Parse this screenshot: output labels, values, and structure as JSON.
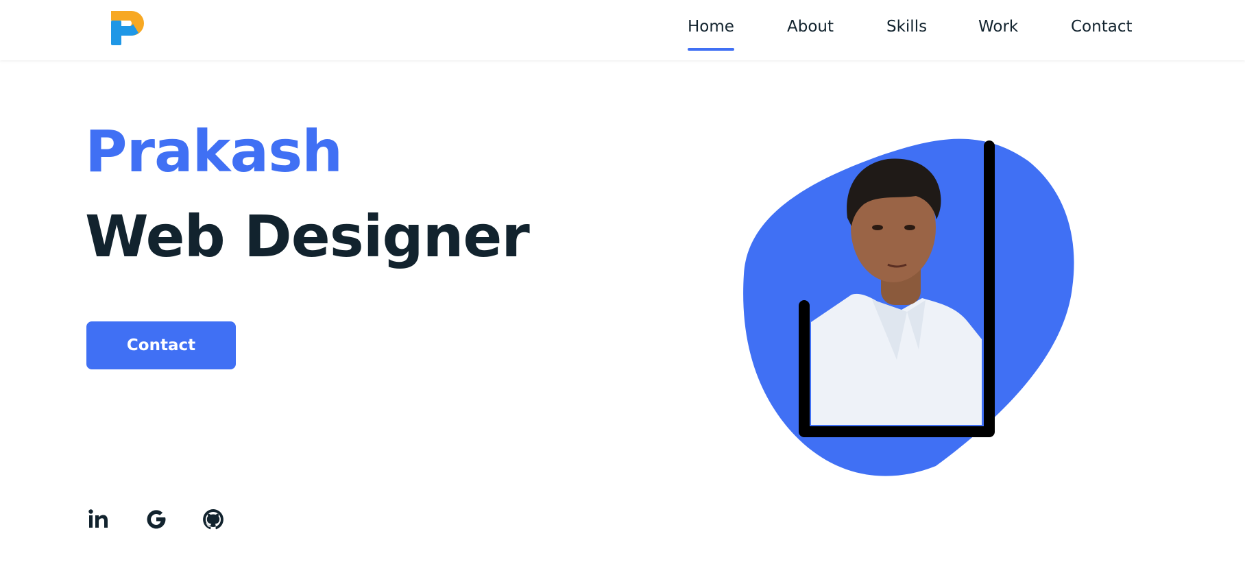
{
  "colors": {
    "accent": "#4070f4",
    "text_dark": "#12232e",
    "background": "#ffffff",
    "logo_orange": "#f7a823",
    "logo_blue": "#1f97e6"
  },
  "header": {
    "logo_icon": "p-logo-icon",
    "nav": [
      {
        "label": "Home",
        "active": true
      },
      {
        "label": "About",
        "active": false
      },
      {
        "label": "Skills",
        "active": false
      },
      {
        "label": "Work",
        "active": false
      },
      {
        "label": "Contact",
        "active": false
      }
    ]
  },
  "hero": {
    "name": "Prakash",
    "role": "Web Designer",
    "button_label": "Contact",
    "image_icon": "profile-photo"
  },
  "social": [
    {
      "icon": "linkedin-icon"
    },
    {
      "icon": "google-icon"
    },
    {
      "icon": "github-icon"
    }
  ]
}
